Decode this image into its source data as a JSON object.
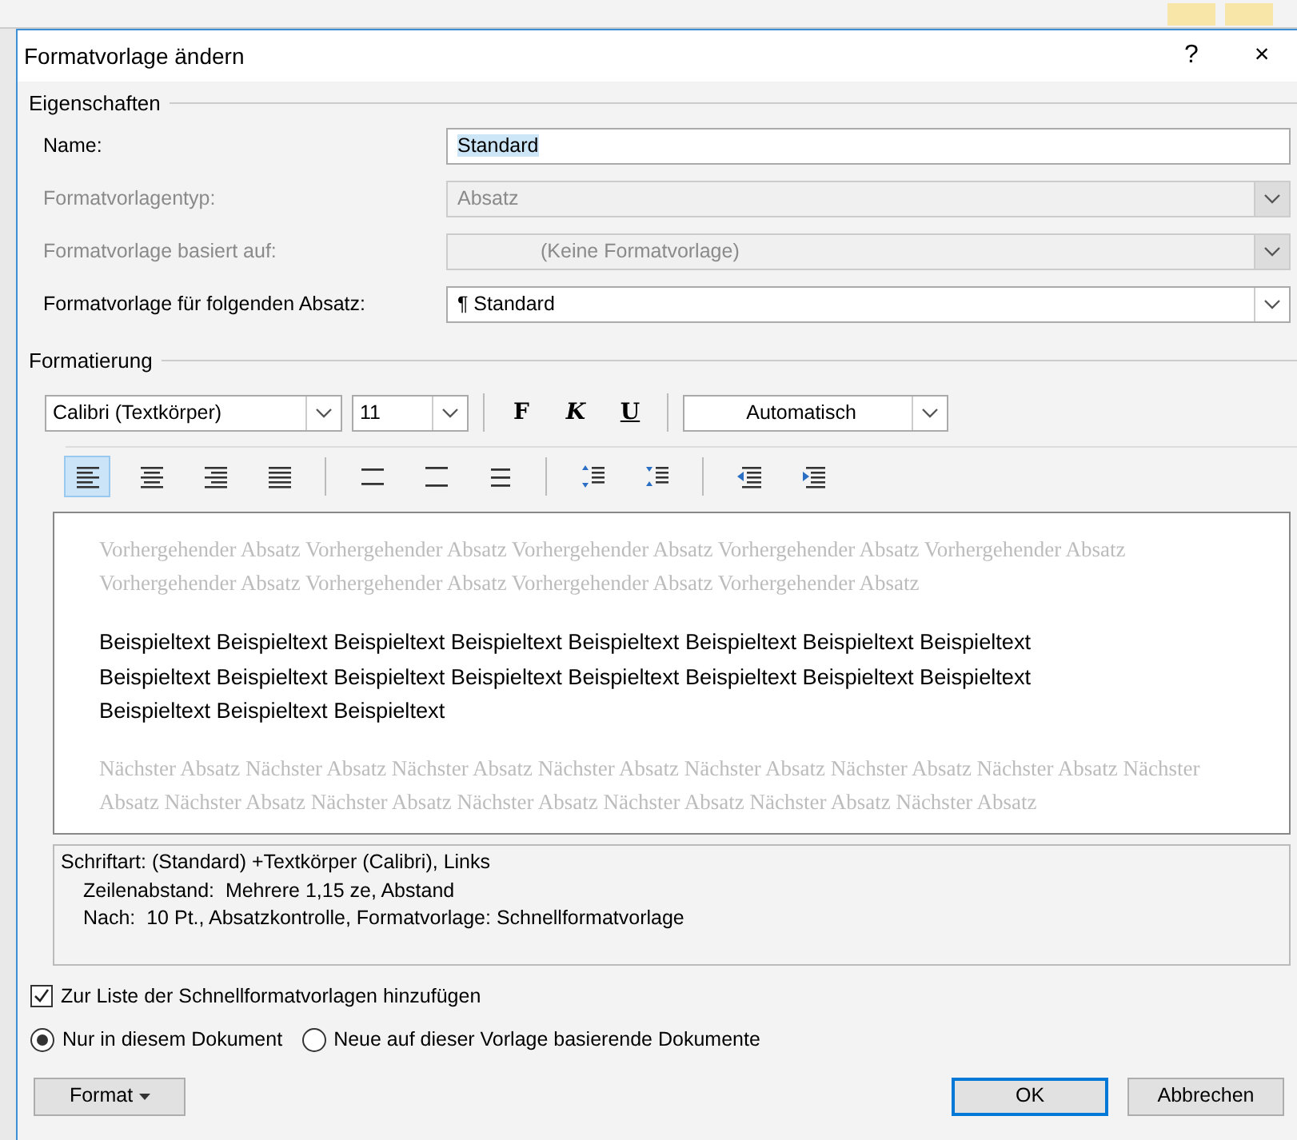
{
  "window": {
    "title": "Formatvorlage ändern",
    "help": "?",
    "close": "×"
  },
  "properties": {
    "legend": "Eigenschaften",
    "fields": [
      {
        "label": "Name:",
        "value": "Standard",
        "kind": "text",
        "disabled": false
      },
      {
        "label": "Formatvorlagentyp:",
        "value": "Absatz",
        "kind": "combo",
        "disabled": true
      },
      {
        "label": "Formatvorlage basiert auf:",
        "value": "(Keine Formatvorlage)",
        "kind": "combo",
        "disabled": true
      },
      {
        "label": "Formatvorlage für folgenden Absatz:",
        "value": "¶ Standard",
        "kind": "combo",
        "disabled": false
      }
    ]
  },
  "formatting": {
    "legend": "Formatierung",
    "font": "Calibri (Textkörper)",
    "size": "11",
    "styles": [
      "F",
      "K",
      "U"
    ],
    "font_color": "Automatisch",
    "tools": [
      {
        "kind": "align-left",
        "selected": true
      },
      {
        "kind": "align-center",
        "selected": false
      },
      {
        "kind": "align-right",
        "selected": false
      },
      {
        "kind": "justify",
        "selected": false
      },
      {
        "kind": "sep"
      },
      {
        "kind": "single-spacing",
        "selected": false
      },
      {
        "kind": "one-half-spacing",
        "selected": false
      },
      {
        "kind": "double-spacing",
        "selected": false
      },
      {
        "kind": "sep"
      },
      {
        "kind": "space-before",
        "selected": false
      },
      {
        "kind": "space-after",
        "selected": false
      },
      {
        "kind": "sep"
      },
      {
        "kind": "indent-decrease",
        "selected": false
      },
      {
        "kind": "indent-increase",
        "selected": false
      }
    ]
  },
  "preview": {
    "previous": "Vorhergehender Absatz Vorhergehender Absatz Vorhergehender Absatz Vorhergehender Absatz Vorhergehender Absatz Vorhergehender Absatz Vorhergehender Absatz Vorhergehender Absatz Vorhergehender Absatz",
    "sample": "Beispieltext Beispieltext Beispieltext Beispieltext Beispieltext Beispieltext Beispieltext Beispieltext Beispieltext Beispieltext Beispieltext Beispieltext Beispieltext Beispieltext Beispieltext Beispieltext Beispieltext Beispieltext Beispieltext",
    "next": "Nächster Absatz Nächster Absatz Nächster Absatz Nächster Absatz Nächster Absatz Nächster Absatz Nächster Absatz Nächster Absatz Nächster Absatz Nächster Absatz Nächster Absatz Nächster Absatz Nächster Absatz Nächster Absatz"
  },
  "description": [
    "Schriftart: (Standard) +Textkörper (Calibri), Links",
    "Zeilenabstand:  Mehrere 1,15 ze, Abstand",
    "Nach:  10 Pt., Absatzkontrolle, Formatvorlage: Schnellformatvorlage"
  ],
  "add_to_quick_styles": {
    "label": "Zur Liste der Schnellformatvorlagen hinzufügen",
    "checked": true
  },
  "scope": [
    {
      "label": "Nur in diesem Dokument",
      "selected": true
    },
    {
      "label": "Neue auf dieser Vorlage basierende Dokumente",
      "selected": false
    }
  ],
  "buttons": {
    "format": "Format",
    "ok": "OK",
    "cancel": "Abbrechen"
  }
}
